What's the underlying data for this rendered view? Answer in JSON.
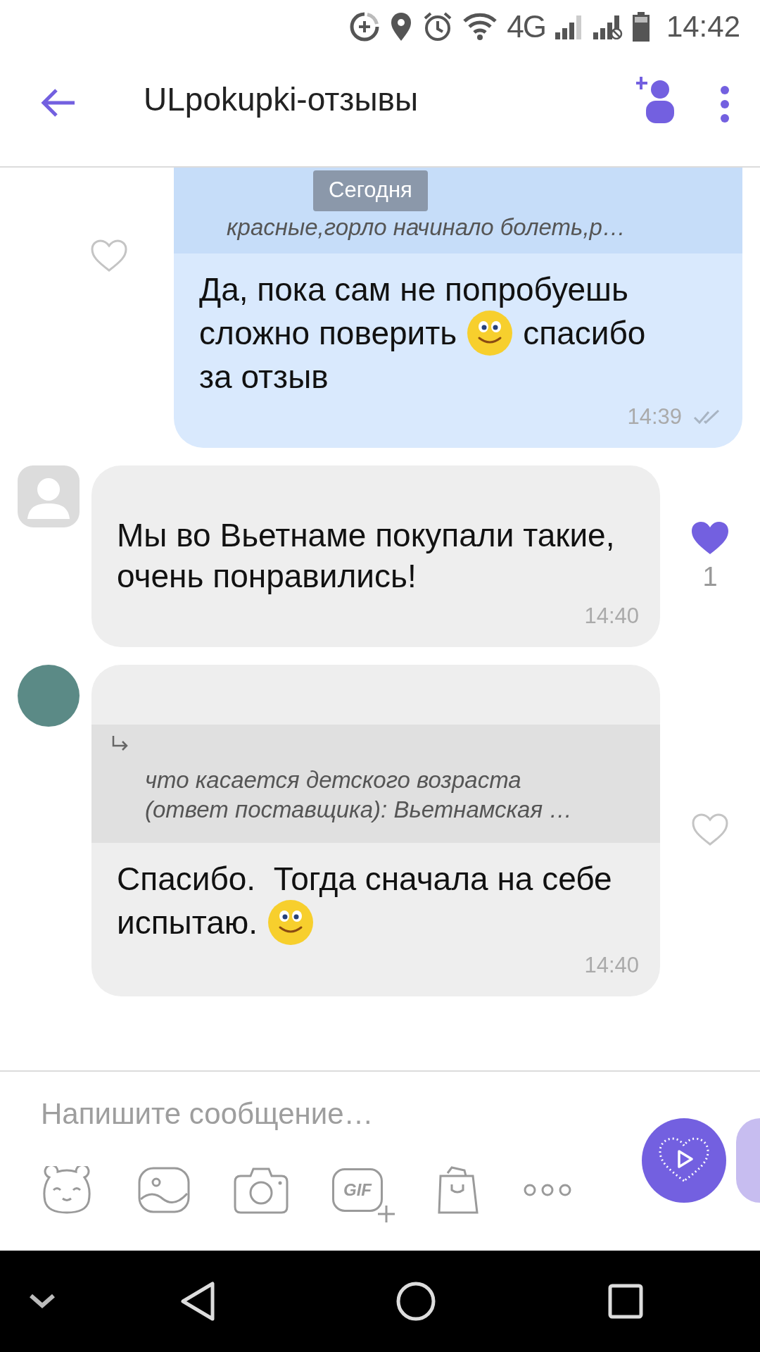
{
  "status_bar": {
    "network": "4G",
    "time": "14:42"
  },
  "header": {
    "title": "ULpokupki-отзывы"
  },
  "date_badge": "Сегодня",
  "messages": [
    {
      "kind": "outgoing",
      "quote": [
        "красные,горло начинало болеть,р…"
      ],
      "body": [
        [
          {
            "kind": "text",
            "text": "Да, пока сам не попробуешь"
          }
        ],
        [
          {
            "kind": "text",
            "text": "сложно поверить"
          },
          {
            "kind": "emoji"
          },
          {
            "kind": "text",
            "text": "спасибо"
          }
        ],
        [
          {
            "kind": "text",
            "text": "за отзыв"
          }
        ]
      ],
      "time": "14:39",
      "liked": false
    },
    {
      "kind": "incoming",
      "avatar": {
        "kind": "silhouette"
      },
      "body": [
        [
          {
            "kind": "text",
            "text": "Мы во Вьетнаме покупали такие, очень понравились!"
          }
        ]
      ],
      "time": "14:40",
      "liked": true,
      "likes": "1"
    },
    {
      "kind": "incoming",
      "avatar": {
        "kind": "photo"
      },
      "reply": [
        "что касается детского возраста",
        "(ответ поставщика): Вьетнамская …"
      ],
      "body": [
        [
          {
            "kind": "text",
            "text": "Спасибо.  Тогда сначала на себе"
          }
        ],
        [
          {
            "kind": "text",
            "text": "испытаю."
          },
          {
            "kind": "emoji"
          }
        ]
      ],
      "time": "14:40",
      "liked": false
    }
  ],
  "composer": {
    "placeholder": "Напишите сообщение…",
    "gif_label": "GIF"
  }
}
